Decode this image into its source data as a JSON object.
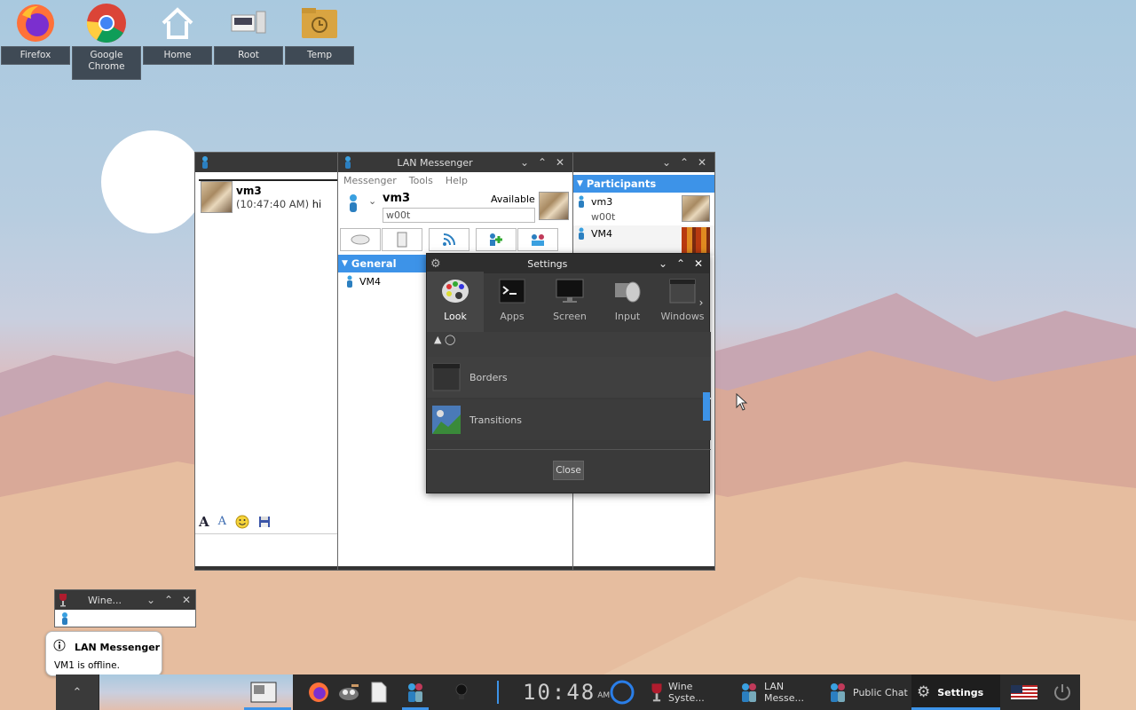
{
  "desktop": {
    "icons": [
      {
        "label": "Firefox",
        "icon": "firefox-icon"
      },
      {
        "label": "Google Chrome",
        "icon": "chrome-icon"
      },
      {
        "label": "Home",
        "icon": "home-icon"
      },
      {
        "label": "Root",
        "icon": "root-icon"
      },
      {
        "label": "Temp",
        "icon": "folder-icon"
      }
    ]
  },
  "chat": {
    "sender": "vm3",
    "timestamp": "(10:47:40 AM)",
    "message": "hi"
  },
  "messenger": {
    "title": "LAN Messenger",
    "menu": [
      "Messenger",
      "Tools",
      "Help"
    ],
    "user_name": "vm3",
    "status": "Available",
    "note": "w00t",
    "group": "General",
    "contacts": [
      "VM4"
    ]
  },
  "participants": {
    "header": "Participants",
    "list": [
      {
        "name": "vm3",
        "note": "w00t"
      },
      {
        "name": "VM4",
        "note": ""
      }
    ]
  },
  "settings": {
    "title": "Settings",
    "tabs": [
      "Look",
      "Apps",
      "Screen",
      "Input",
      "Windows"
    ],
    "active_tab": "Look",
    "rows": [
      "Borders",
      "Transitions"
    ],
    "close_label": "Close"
  },
  "wine": {
    "title": "Wine..."
  },
  "notification": {
    "title": "LAN Messenger",
    "body": "VM1 is offline."
  },
  "taskbar": {
    "clock": "10:48",
    "ampm": "AM",
    "tasks": [
      {
        "label": "Wine Syste...",
        "icon": "wine-icon"
      },
      {
        "label": "LAN Messe...",
        "icon": "lan-messenger-icon"
      },
      {
        "label": "Public Chat",
        "icon": "lan-messenger-icon"
      },
      {
        "label": "Settings",
        "icon": "gear-icon"
      }
    ],
    "colors": {
      "bar": "#2b2b2b",
      "accent": "#3d93e8"
    }
  }
}
